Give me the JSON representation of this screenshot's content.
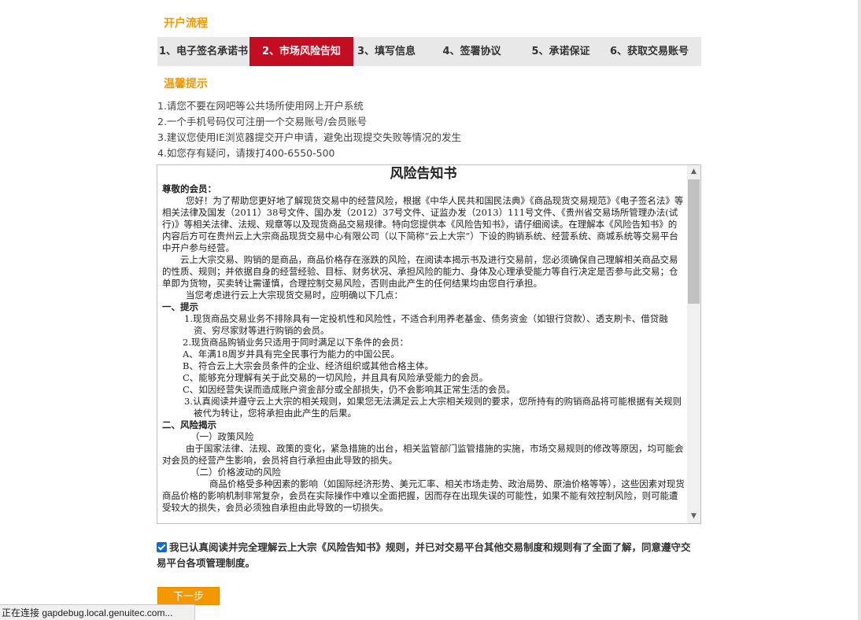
{
  "flow": {
    "title": "开户流程",
    "steps": [
      {
        "label": "1、电子签名承诺书"
      },
      {
        "label": "2、市场风险告知"
      },
      {
        "label": "3、填写信息"
      },
      {
        "label": "4、签署协议"
      },
      {
        "label": "5、承诺保证"
      },
      {
        "label": "6、获取交易账号"
      }
    ],
    "active_step": 2,
    "active_color": "#c30d23"
  },
  "tips": {
    "title": "温馨提示",
    "items": [
      "1.请您不要在网吧等公共场所使用网上开户系统",
      "2.一个手机号码仅可注册一个交易账号/会员账号",
      "3.建议您使用IE浏览器提交开户申请，避免出现提交失败等情况的发生",
      "4.如您存有疑问，请拨打400-6550-500"
    ]
  },
  "notice": {
    "title": "风险告知书",
    "greeting": "尊敬的会员：",
    "paragraphs": {
      "p1": "您好！为了帮助您更好地了解现货交易中的经营风险，根据《中华人民共和国民法典》《商品现货交易规范》《电子签名法》等相关法律及国发（2011）38号文件、国办发（2012）37号文件、证监办发（2013）111号文件、《贵州省交易场所管理办法(试行)》等相关法律、法规、规章等以及现货商品交易规律。特向您提供本《风险告知书》，请仔细阅读。在理解本《风险告知书》的内容后方可在贵州云上大宗商品现货交易中心有限公司（以下简称“云上大宗”）下设的购销系统、经营系统、商城系统等交易平台中开户参与经营。",
      "p2": "云上大宗交易、购销的是商品，商品价格存在涨跌的风险，在阅读本揭示书及进行交易前，您必须确保自己理解相关商品交易的性质、规则；并依据自身的经营经验、目标、财务状况、承担风险的能力、身体及心理承受能力等自行决定是否参与此交易；仓单即为货物，买卖转让需谨慎，合理控制交易风险，否则由此产生的任何结果均由您自行承担。",
      "p3": "当您考虑进行云上大宗现货交易时，应明确以下几点：",
      "h1": "一、提示",
      "h1_1": "1.现货商品交易业务不排除具有一定投机性和风险性，不适合利用养老基金、债务资金（如银行贷款）、透支刷卡、借贷融资、穷尽家财等进行购销的会员。",
      "h1_2": "2.现货商品购销业务只适用于同时满足以下条件的会员：",
      "h1_2a": "A、年满18周岁并具有完全民事行为能力的中国公民。",
      "h1_2b": "B、符合云上大宗会员条件的企业、经济组织或其他合格主体。",
      "h1_2c": "C、能够充分理解有关于此交易的一切风险，并且具有风险承受能力的会员。",
      "h1_2d": "C、如因经营失误而造成账户资金部分或全部损失，仍不会影响其正常生活的会员。",
      "h1_3": "3.认真阅读并遵守云上大宗的相关规则，如果您无法满足云上大宗相关规则的要求，您所持有的购销商品将可能根据有关规则被代为转让，您将承担由此产生的后果。",
      "h2": "二、风险揭示",
      "h2_1t": "（一）政策风险",
      "h2_1": "由于国家法律、法规、政策的变化，紧急措施的出台，相关监管部门监管措施的实施，市场交易规则的修改等原因，均可能会对会员的经营产生影响，会员将自行承担由此导致的损失。",
      "h2_2t": "（二）价格波动的风险",
      "h2_2": "商品价格受多种因素的影响（如国际经济形势、美元汇率、相关市场走势、政治局势、原油价格等等），这些因素对现货商品价格的影响机制非常复杂，会员在实际操作中难以全面把握，因而存在出现失误的可能性，如果不能有效控制风险，则可能遭受较大的损失，会员必须独自承担由此导致的一切损失。"
    }
  },
  "agreement": {
    "checked": true,
    "text": "我已认真阅读并完全理解云上大宗《风险告知书》规则，并已对交易平台其他交易制度和规则有了全面了解，同意遵守交易平台各项管理制度。"
  },
  "next_button": {
    "label": "下一步",
    "color": "#f39800"
  },
  "status_bar": {
    "text": "正在连接 gapdebug.local.genuitec.com..."
  },
  "icons": {
    "scroll_up": "chevron-up-icon",
    "scroll_down": "chevron-down-icon",
    "checkbox": "checkmark-icon"
  }
}
